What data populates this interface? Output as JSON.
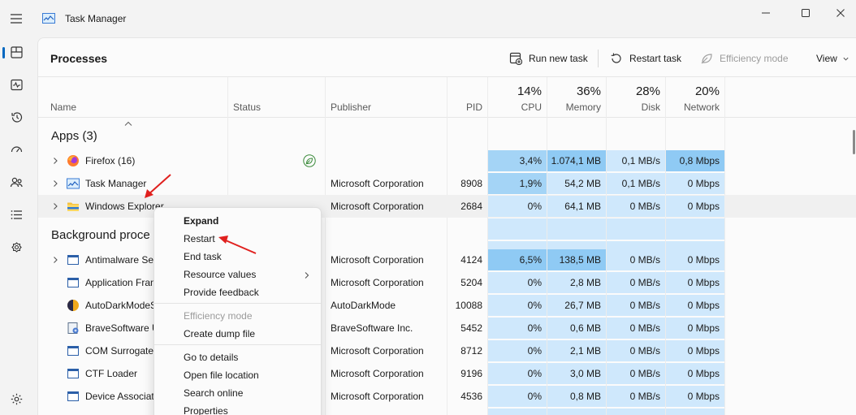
{
  "window": {
    "title": "Task Manager",
    "icon": "task-manager-icon"
  },
  "rail": {
    "items": [
      {
        "icon": "processes-icon",
        "active": true
      },
      {
        "icon": "performance-icon"
      },
      {
        "icon": "app-history-icon"
      },
      {
        "icon": "startup-apps-icon"
      },
      {
        "icon": "users-icon"
      },
      {
        "icon": "details-icon"
      },
      {
        "icon": "services-icon"
      }
    ],
    "settings_icon": "settings-icon"
  },
  "toolbar": {
    "title": "Processes",
    "run_new_task": "Run new task",
    "restart_task": "Restart task",
    "efficiency_mode": "Efficiency mode",
    "view": "View"
  },
  "columns": {
    "name": "Name",
    "status": "Status",
    "publisher": "Publisher",
    "pid": "PID",
    "cpu_pct": "14%",
    "cpu": "CPU",
    "memory_pct": "36%",
    "memory": "Memory",
    "disk_pct": "28%",
    "disk": "Disk",
    "network_pct": "20%",
    "network": "Network"
  },
  "groups": {
    "apps": "Apps (3)",
    "background": "Background proce"
  },
  "apps": [
    {
      "name": "Firefox (16)",
      "icon": "firefox-icon",
      "status_icon": "efficiency-leaf-icon",
      "publisher": "",
      "pid": "",
      "cpu": "3,4%",
      "memory": "1.074,1 MB",
      "disk": "0,1 MB/s",
      "network": "0,8 Mbps"
    },
    {
      "name": "Task Manager",
      "icon": "task-manager-icon",
      "publisher": "Microsoft Corporation",
      "pid": "8908",
      "cpu": "1,9%",
      "memory": "54,2 MB",
      "disk": "0,1 MB/s",
      "network": "0 Mbps"
    },
    {
      "name": "Windows Explorer",
      "icon": "folder-icon",
      "publisher": "Microsoft Corporation",
      "pid": "2684",
      "cpu": "0%",
      "memory": "64,1 MB",
      "disk": "0 MB/s",
      "network": "0 Mbps"
    }
  ],
  "background": [
    {
      "name": "Antimalware Ser",
      "icon": "app-window-icon",
      "expand": true,
      "publisher": "Microsoft Corporation",
      "pid": "4124",
      "cpu": "6,5%",
      "memory": "138,5 MB",
      "disk": "0 MB/s",
      "network": "0 Mbps"
    },
    {
      "name": "Application Fran",
      "icon": "app-window-icon",
      "publisher": "Microsoft Corporation",
      "pid": "5204",
      "cpu": "0%",
      "memory": "2,8 MB",
      "disk": "0 MB/s",
      "network": "0 Mbps"
    },
    {
      "name": "AutoDarkModeS",
      "icon": "autodarkmode-icon",
      "publisher": "AutoDarkMode",
      "pid": "10088",
      "cpu": "0%",
      "memory": "26,7 MB",
      "disk": "0 MB/s",
      "network": "0 Mbps"
    },
    {
      "name": "BraveSoftware U",
      "icon": "brave-update-icon",
      "publisher": "BraveSoftware Inc.",
      "pid": "5452",
      "cpu": "0%",
      "memory": "0,6 MB",
      "disk": "0 MB/s",
      "network": "0 Mbps"
    },
    {
      "name": "COM Surrogate",
      "icon": "app-window-icon",
      "publisher": "Microsoft Corporation",
      "pid": "8712",
      "cpu": "0%",
      "memory": "2,1 MB",
      "disk": "0 MB/s",
      "network": "0 Mbps"
    },
    {
      "name": "CTF Loader",
      "icon": "app-window-icon",
      "publisher": "Microsoft Corporation",
      "pid": "9196",
      "cpu": "0%",
      "memory": "3,0 MB",
      "disk": "0 MB/s",
      "network": "0 Mbps"
    },
    {
      "name": "Device Associati",
      "icon": "app-window-icon",
      "publisher": "Microsoft Corporation",
      "pid": "4536",
      "cpu": "0%",
      "memory": "0,8 MB",
      "disk": "0 MB/s",
      "network": "0 Mbps"
    }
  ],
  "context_menu": {
    "expand": "Expand",
    "restart": "Restart",
    "end_task": "End task",
    "resource_values": "Resource values",
    "provide_feedback": "Provide feedback",
    "efficiency_mode": "Efficiency mode",
    "create_dump_file": "Create dump file",
    "go_to_details": "Go to details",
    "open_file_location": "Open file location",
    "search_online": "Search online",
    "properties": "Properties"
  },
  "colors": {
    "accent": "#0067c0",
    "res_light": "#cfe8fc",
    "res_medium": "#a4d4f6",
    "res_strong": "#8fcaf4",
    "annotation_arrow": "#e0201e"
  }
}
